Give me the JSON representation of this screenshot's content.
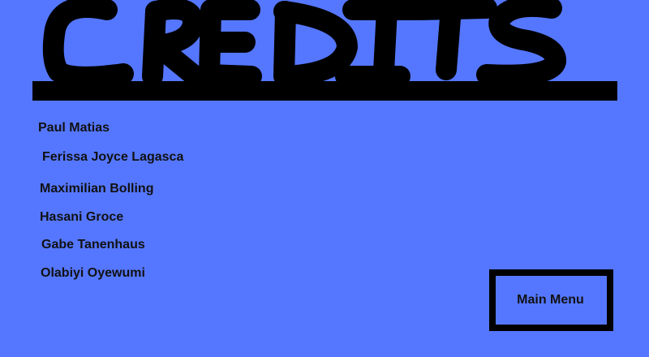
{
  "screen": {
    "title": "CREDITS",
    "background_color": "#5577ff",
    "ink_color": "#000000"
  },
  "credits": {
    "names": [
      "Paul Matias",
      "Ferissa Joyce Lagasca",
      "Maximilian Bolling",
      "Hasani Groce",
      "Gabe Tanenhaus",
      "Olabiyi Oyewumi"
    ]
  },
  "buttons": {
    "main_menu_label": "Main Menu"
  }
}
